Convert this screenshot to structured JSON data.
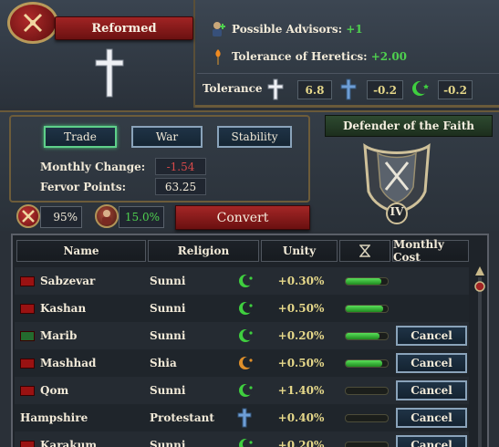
{
  "religion": {
    "name": "Reformed",
    "advisors_label": "Possible Advisors:",
    "advisors_value": "+1",
    "heretic_label": "Tolerance of Heretics:",
    "heretic_value": "+2.00",
    "tolerance_label": "Tolerance",
    "tolerance_true": "6.8",
    "tolerance_heretic": "-0.2",
    "tolerance_heathen": "-0.2"
  },
  "aspects": {
    "buttons": [
      "Trade",
      "War",
      "Stability"
    ],
    "active": "Trade"
  },
  "stats": {
    "monthly_change_label": "Monthly Change:",
    "monthly_change_value": "-1.54",
    "fervor_label": "Fervor Points:",
    "fervor_value": "63.25",
    "pct_a": "95%",
    "pct_b": "15.0%",
    "convert_label": "Convert"
  },
  "defender": {
    "title": "Defender of the Faith",
    "rank": "IV"
  },
  "table": {
    "headers": [
      "Name",
      "Religion",
      "Unity",
      "",
      "Monthly Cost"
    ],
    "rows": [
      {
        "name": "Sabzevar",
        "religion": "Sunni",
        "unity": "+0.30%",
        "bar": 0.85,
        "cancel": "",
        "flag": "red",
        "sym": "crescent-green"
      },
      {
        "name": "Kashan",
        "religion": "Sunni",
        "unity": "+0.50%",
        "bar": 0.9,
        "cancel": "",
        "flag": "red",
        "sym": "crescent-green"
      },
      {
        "name": "Marib",
        "religion": "Sunni",
        "unity": "+0.20%",
        "bar": 0.8,
        "cancel": "Cancel",
        "flag": "green",
        "sym": "crescent-green"
      },
      {
        "name": "Mashhad",
        "religion": "Shia",
        "unity": "+0.50%",
        "bar": 0.88,
        "cancel": "Cancel",
        "flag": "red",
        "sym": "crescent-orange"
      },
      {
        "name": "Qom",
        "religion": "Sunni",
        "unity": "+1.40%",
        "bar": 0.0,
        "cancel": "Cancel",
        "flag": "red",
        "sym": "crescent-green"
      },
      {
        "name": "Hampshire",
        "religion": "Protestant",
        "unity": "+0.40%",
        "bar": 0.0,
        "cancel": "Cancel",
        "flag": "",
        "sym": "cross-blue"
      },
      {
        "name": "Karakum",
        "religion": "Sunni",
        "unity": "+0.20%",
        "bar": 0.0,
        "cancel": "Cancel",
        "flag": "red",
        "sym": "crescent-green"
      }
    ]
  },
  "colors": {
    "accent_red": "#a12424",
    "positive_green": "#4fd04f",
    "negative_red": "#d94a4a",
    "unity_gold": "#e6d88a"
  }
}
